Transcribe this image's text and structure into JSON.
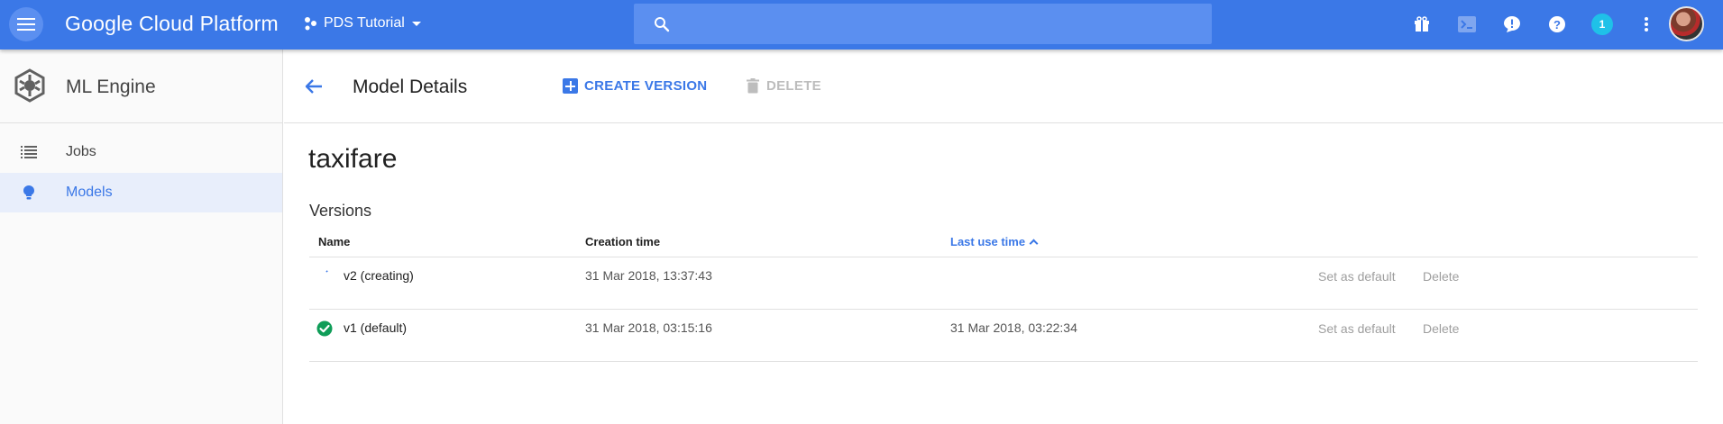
{
  "topbar": {
    "brand": "Google Cloud Platform",
    "project": "PDS Tutorial",
    "search_placeholder": "",
    "notification_count": "1",
    "colors": {
      "bar": "#3b78e7",
      "badge": "#1fc1e8"
    }
  },
  "sidebar": {
    "product": "ML Engine",
    "items": [
      {
        "label": "Jobs",
        "icon": "list-icon",
        "active": false
      },
      {
        "label": "Models",
        "icon": "lightbulb-icon",
        "active": true
      }
    ]
  },
  "actionbar": {
    "title": "Model Details",
    "create_label": "CREATE VERSION",
    "delete_label": "DELETE"
  },
  "model": {
    "name": "taxifare",
    "versions_label": "Versions"
  },
  "table": {
    "headers": {
      "name": "Name",
      "created": "Creation time",
      "last_use": "Last use time"
    },
    "rows": [
      {
        "name": "v2 (creating)",
        "created": "31 Mar 2018, 13:37:43",
        "last_use": "",
        "status": "creating",
        "set_default": "Set as default",
        "delete": "Delete"
      },
      {
        "name": "v1 (default)",
        "created": "31 Mar 2018, 03:15:16",
        "last_use": "31 Mar 2018, 03:22:34",
        "status": "ready",
        "set_default": "Set as default",
        "delete": "Delete"
      }
    ]
  }
}
